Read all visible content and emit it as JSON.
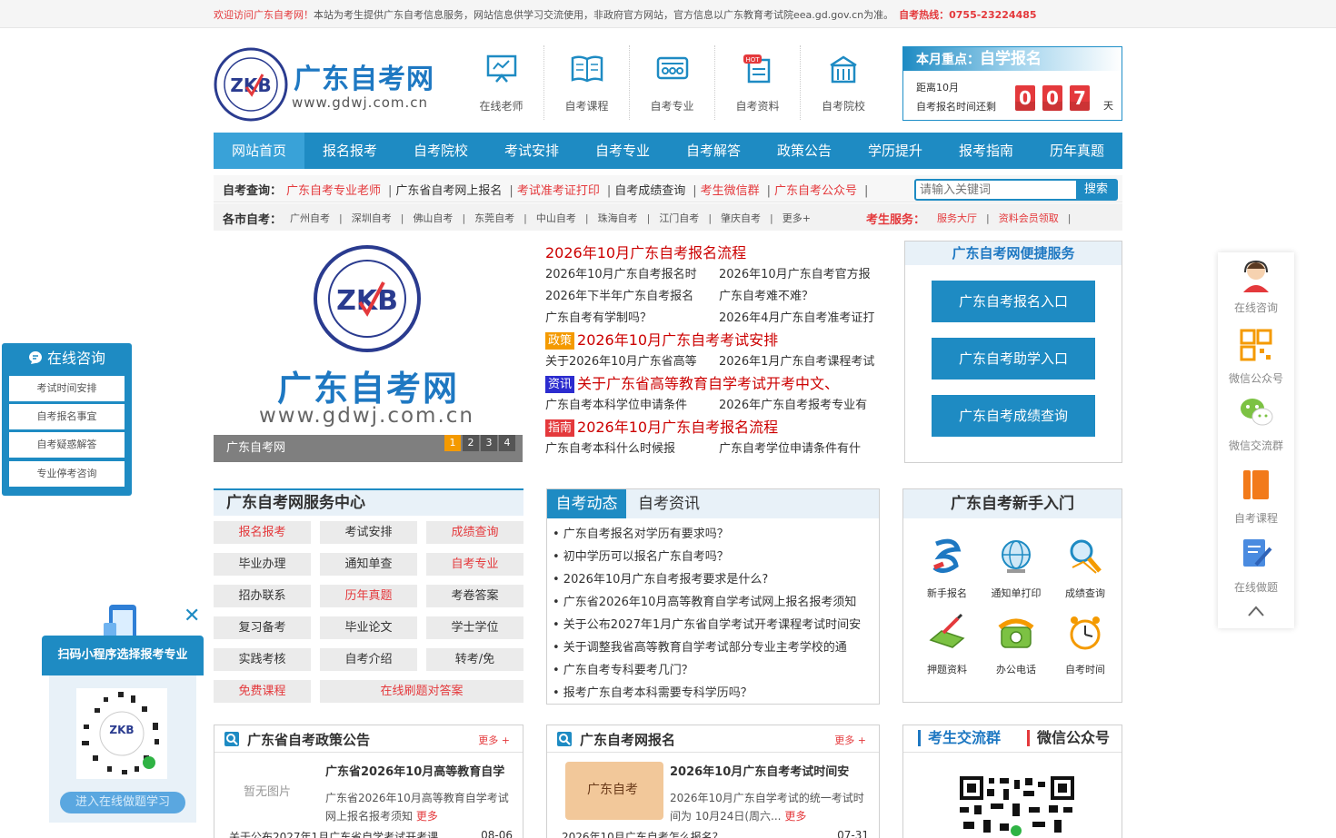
{
  "topbar": {
    "welcome": "欢迎访问广东自考网！",
    "notice": "本站为考生提供广东自考信息服务，网站信息供学习交流使用，非政府官方网站，官方信息以广东教育考试院eea.gd.gov.cn为准。",
    "hotline": "自考热线：0755-23224485"
  },
  "logo": {
    "title": "广东自考网",
    "url": "www.gdwj.com.cn",
    "badge": "ZKB"
  },
  "nav_icons": [
    "在线老师",
    "自考课程",
    "自考专业",
    "自考资料",
    "自考院校"
  ],
  "focus": {
    "prefix": "本月重点：",
    "title": "自学报名",
    "line1": "距离10月",
    "line2": "自考报名时间还剩",
    "digits": [
      "0",
      "0",
      "7"
    ],
    "unit": "天"
  },
  "main_nav": [
    "网站首页",
    "报名报考",
    "自考院校",
    "考试安排",
    "自考专业",
    "自考解答",
    "政策公告",
    "学历提升",
    "报考指南",
    "历年真题"
  ],
  "query": {
    "label": "自考查询：",
    "links": [
      {
        "text": "广东自考专业老师",
        "red": true
      },
      {
        "text": "广东省自考网上报名",
        "red": false
      },
      {
        "text": "考试准考证打印",
        "red": true
      },
      {
        "text": "自考成绩查询",
        "red": false
      },
      {
        "text": "考生微信群",
        "red": true
      },
      {
        "text": "广东自考公众号",
        "red": true
      }
    ],
    "placeholder": "请输入关键词",
    "search_label": "搜索"
  },
  "city": {
    "label": "各市自考：",
    "links": [
      "广州自考",
      "深圳自考",
      "佛山自考",
      "东莞自考",
      "中山自考",
      "珠海自考",
      "江门自考",
      "肇庆自考",
      "更多+"
    ],
    "service_label": "考生服务：",
    "service_links": [
      "服务大厅",
      "资料会员领取"
    ]
  },
  "slider": {
    "big_title": "广东自考网",
    "big_url": "www.gdwj.com.cn",
    "caption": "广东自考网",
    "pages": [
      "1",
      "2",
      "3",
      "4"
    ]
  },
  "news": {
    "headline": "2026年10月广东自考报名流程",
    "rows1": [
      [
        "2026年10月广东自考报名时",
        "2026年10月广东自考官方报"
      ],
      [
        "2026年下半年广东自考报名",
        "广东自考难不难？"
      ],
      [
        "广东自考有学制吗？",
        "2026年4月广东自考准考证打"
      ]
    ],
    "tag1": {
      "tag": "政策",
      "title": "2026年10月广东自考考试安排"
    },
    "rows2": [
      [
        "关于2026年10月广东省高等",
        "2026年1月广东自考课程考试"
      ]
    ],
    "tag2": {
      "tag": "资讯",
      "title": "关于广东省高等教育自学考试开考中文、"
    },
    "rows3": [
      [
        "广东自考本科学位申请条件",
        "2026年广东自考报考专业有"
      ]
    ],
    "tag3": {
      "tag": "指南",
      "title": "2026年10月广东自考报名流程"
    },
    "rows4": [
      [
        "广东自考本科什么时候报",
        "广东自考学位申请条件有什"
      ]
    ]
  },
  "quick": {
    "title": "广东自考网便捷服务",
    "buttons": [
      "广东自考报名入口",
      "广东自考助学入口",
      "广东自考成绩查询"
    ]
  },
  "service_center": {
    "title": "广东自考网服务中心",
    "buttons": [
      {
        "text": "报名报考",
        "red": true
      },
      {
        "text": "考试安排",
        "red": false
      },
      {
        "text": "成绩查询",
        "red": true
      },
      {
        "text": "毕业办理",
        "red": false
      },
      {
        "text": "通知单查",
        "red": false
      },
      {
        "text": "自考专业",
        "red": true
      },
      {
        "text": "招办联系",
        "red": false
      },
      {
        "text": "历年真题",
        "red": true
      },
      {
        "text": "考卷答案",
        "red": false
      },
      {
        "text": "复习备考",
        "red": false
      },
      {
        "text": "毕业论文",
        "red": false
      },
      {
        "text": "学士学位",
        "red": false
      },
      {
        "text": "实践考核",
        "red": false
      },
      {
        "text": "自考介绍",
        "red": false
      },
      {
        "text": "转考/免",
        "red": false
      }
    ],
    "free_course": "免费课程",
    "online_quiz": "在线刷题对答案"
  },
  "dynamic": {
    "tab_active": "自考动态",
    "tab_other": "自考资讯",
    "items": [
      "• 广东自考报名对学历有要求吗？",
      "• 初中学历可以报名广东自考吗？",
      "• 2026年10月广东自考报考要求是什么?",
      "• 广东省2026年10月高等教育自学考试网上报名报考须知",
      "• 关于公布2027年1月广东省自学考试开考课程考试时间安",
      "• 关于调整我省高等教育自学考试部分专业主考学校的通",
      "• 广东自考专科要考几门？",
      "• 报考广东自考本科需要专科学历吗？"
    ]
  },
  "newbie": {
    "title": "广东自考新手入门",
    "items": [
      "新手报名",
      "通知单打印",
      "成绩查询",
      "押题资料",
      "办公电话",
      "自考时间"
    ]
  },
  "policy": {
    "title": "广东省自考政策公告",
    "more": "更多 +",
    "no_image": "暂无图片",
    "item_title": "广东省2026年10月高等教育自学",
    "item_desc": "广东省2026年10月高等教育自学考试网上报名报考须知",
    "item_more": "更多",
    "bottom_item": "关于公布2027年1月广东省自学考试开考课",
    "bottom_date": "08-06"
  },
  "enroll": {
    "title": "广东自考网报名",
    "more": "更多 +",
    "img_text": "广东自考",
    "item_title": "2026年10月广东自考考试时间安",
    "item_desc": "2026年10月广东自学考试的统一考试时间为 10月24日(周六...",
    "item_more": "更多",
    "bottom_item": "2026年10月广东自考怎么报名？",
    "bottom_date": "07-31"
  },
  "qr": {
    "tab1": "考生交流群",
    "tab2": "微信公众号"
  },
  "left_float": {
    "title": "在线咨询",
    "items": [
      "考试时间安排",
      "自考报名事宜",
      "自考疑惑解答",
      "专业停考咨询"
    ]
  },
  "mini_program": {
    "title": "扫码小程序选择报考专业",
    "button": "进入在线做题学习",
    "close": "✕"
  },
  "right_float": [
    "在线咨询",
    "微信公众号",
    "微信交流群",
    "自考课程",
    "在线做题"
  ],
  "colors": {
    "primary": "#1e8bc3",
    "red": "#e4393c",
    "orange": "#f49a00"
  }
}
